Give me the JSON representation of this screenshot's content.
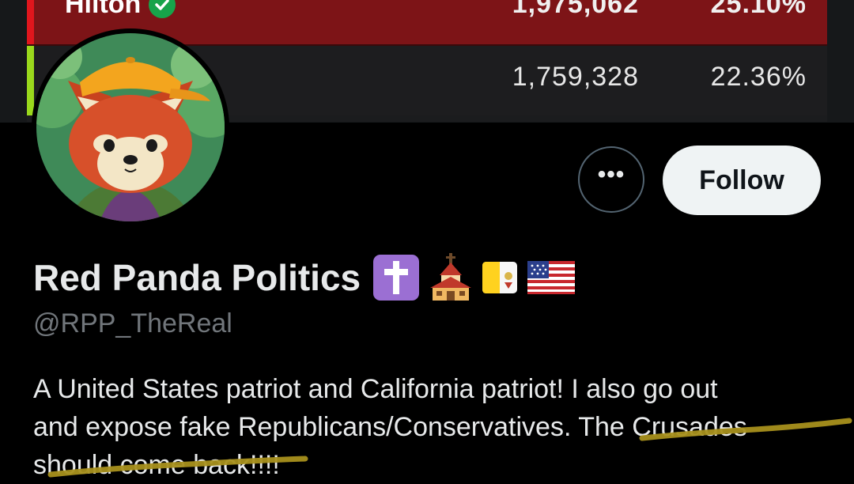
{
  "banner": {
    "rows": [
      {
        "candidate": "Hilton",
        "verified": true,
        "votes": "1,975,062",
        "percent": "25.10%"
      },
      {
        "candidate": "",
        "verified": false,
        "votes": "1,759,328",
        "percent": "22.36%"
      }
    ],
    "colors": {
      "row1_bar": "#e0161d",
      "row2_bar": "#9ad81c",
      "row1_bg": "#7d1417"
    }
  },
  "profile": {
    "display_name": "Red Panda Politics",
    "name_emojis": [
      "latin-cross-icon",
      "church-icon",
      "vatican-flag-icon",
      "us-flag-icon"
    ],
    "handle": "@RPP_TheReal",
    "bio_line1": "A United States patriot and California patriot! I also go out",
    "bio_line2": "and expose fake Republicans/Conservatives. The Crusades",
    "bio_line3": "should come back!!!!",
    "highlight_color": "#a8901c"
  },
  "actions": {
    "more_label": "•••",
    "follow_label": "Follow"
  }
}
